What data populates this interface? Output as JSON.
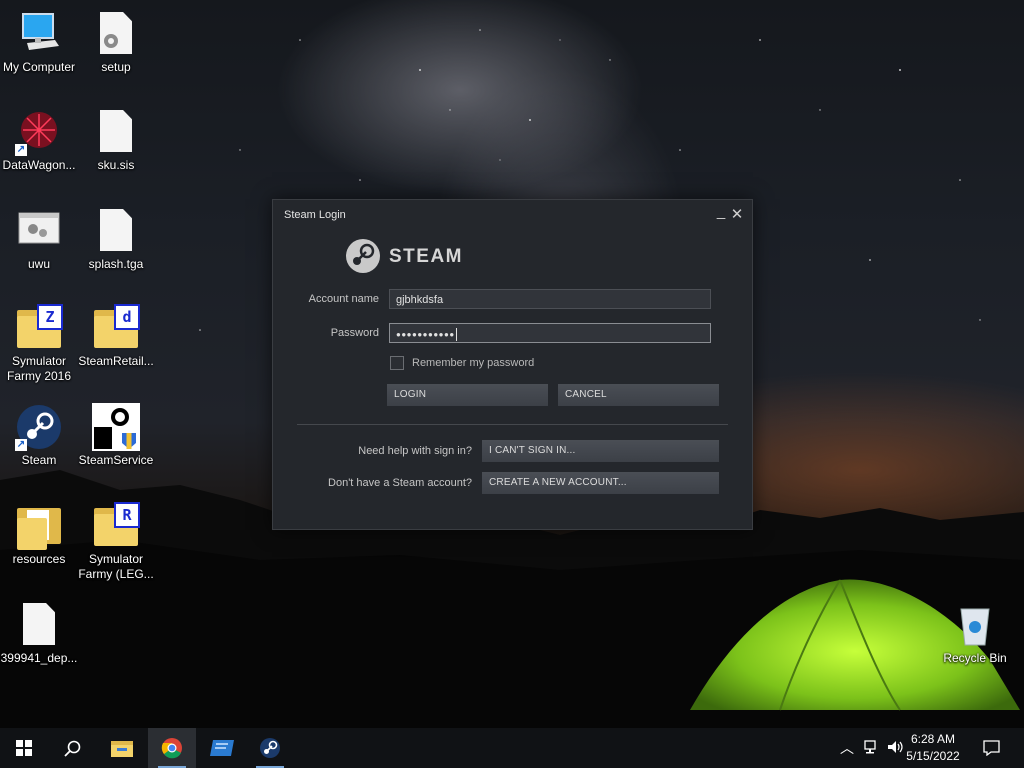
{
  "desktop": {
    "icons": [
      {
        "label": "My Computer"
      },
      {
        "label": "setup"
      },
      {
        "label": "DataWagon..."
      },
      {
        "label": "sku.sis"
      },
      {
        "label": "uwu"
      },
      {
        "label": "splash.tga"
      },
      {
        "label": "Symulator Farmy 2016",
        "badge": "Z"
      },
      {
        "label": "SteamRetail...",
        "badge": "d"
      },
      {
        "label": "Steam"
      },
      {
        "label": "SteamService"
      },
      {
        "label": "resources"
      },
      {
        "label": "Symulator Farmy (LEG...",
        "badge": "R"
      },
      {
        "label": "399941_dep..."
      },
      {
        "label": "Recycle Bin"
      }
    ]
  },
  "login_window": {
    "title": "Steam Login",
    "logo_text": "STEAM",
    "account_label": "Account name",
    "account_value": "gjbhkdsfa",
    "password_label": "Password",
    "password_value": "●●●●●●●●●●●",
    "remember_label": "Remember my password",
    "remember_checked": false,
    "login_button": "LOGIN",
    "cancel_button": "CANCEL",
    "help_question": "Need help with sign in?",
    "help_button": "I CAN'T SIGN IN...",
    "account_question": "Don't have a Steam account?",
    "create_button": "CREATE A NEW ACCOUNT..."
  },
  "taskbar": {
    "apps": [
      "start",
      "search",
      "file-explorer",
      "chrome",
      "remote-app",
      "steam"
    ],
    "clock_time": "6:28 AM",
    "clock_date": "5/15/2022"
  },
  "colors": {
    "window_bg": "#24272c",
    "button_bg": "#43474e",
    "taskbar_bg": "#101215"
  }
}
